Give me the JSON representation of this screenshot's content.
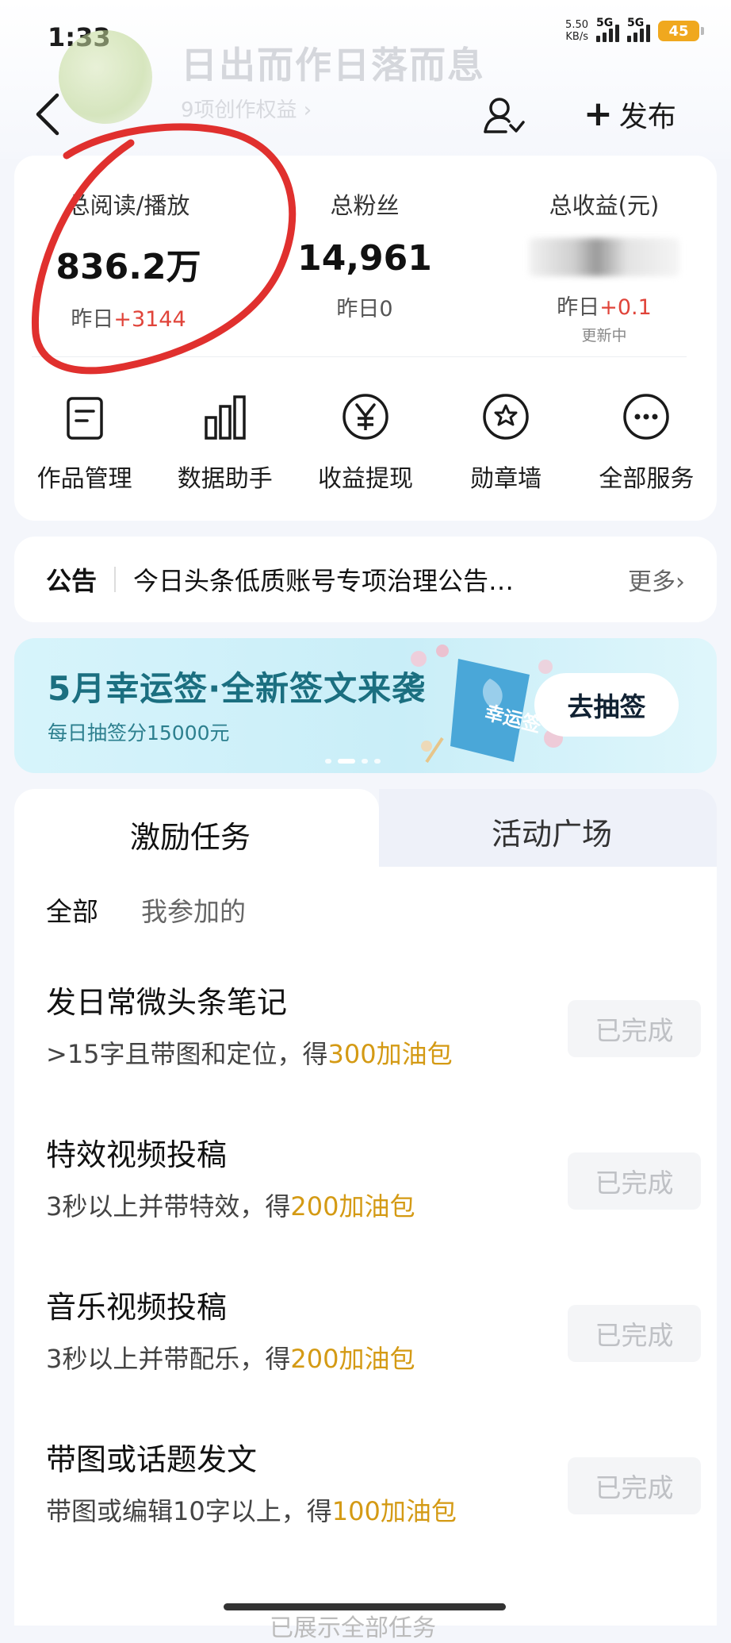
{
  "status_bar": {
    "time": "1:33",
    "net_speed": "5.50",
    "net_unit": "KB/s",
    "signal1": "5G",
    "signal2": "5G",
    "battery": "45"
  },
  "header": {
    "username": "日出而作日落而息",
    "rights": "9项创作权益 ›",
    "publish_label": "发布"
  },
  "stats": [
    {
      "label": "总阅读/播放",
      "value": "836.2万",
      "sub_prefix": "昨日",
      "sub_value": "+3144"
    },
    {
      "label": "总粉丝",
      "value": "14,961",
      "sub_prefix": "昨日0",
      "sub_value": ""
    },
    {
      "label": "总收益(元)",
      "value": "",
      "sub_prefix": "昨日",
      "sub_value": "+0.1",
      "note": "更新中"
    }
  ],
  "services": [
    {
      "label": "作品管理",
      "icon": "document-icon"
    },
    {
      "label": "数据助手",
      "icon": "bar-chart-icon"
    },
    {
      "label": "收益提现",
      "icon": "yen-icon"
    },
    {
      "label": "勋章墙",
      "icon": "medal-icon"
    },
    {
      "label": "全部服务",
      "icon": "more-icon"
    }
  ],
  "notice": {
    "tag": "公告",
    "text": "今日头条低质账号专项治理公告…",
    "more": "更多›"
  },
  "banner": {
    "title": "5月幸运签·全新签文来袭",
    "subtitle": "每日抽签分15000元",
    "button": "去抽签",
    "badge": "幸运签"
  },
  "tabs": {
    "active": "激励任务",
    "inactive": "活动广场"
  },
  "filters": {
    "all": "全部",
    "mine": "我参加的"
  },
  "tasks": [
    {
      "title": "发日常微头条笔记",
      "desc_prefix": ">15字且带图和定位，得",
      "reward": "300加油包",
      "status": "已完成"
    },
    {
      "title": "特效视频投稿",
      "desc_prefix": "3秒以上并带特效，得",
      "reward": "200加油包",
      "status": "已完成"
    },
    {
      "title": "音乐视频投稿",
      "desc_prefix": "3秒以上并带配乐，得",
      "reward": "200加油包",
      "status": "已完成"
    },
    {
      "title": "带图或话题发文",
      "desc_prefix": "带图或编辑10字以上，得",
      "reward": "100加油包",
      "status": "已完成"
    }
  ],
  "footer": {
    "text": "已展示全部任务"
  },
  "colors": {
    "accent_red": "#e0443a",
    "reward_gold": "#d49a14",
    "banner_teal": "#1b6f80",
    "annotation_red": "#e0302e"
  }
}
